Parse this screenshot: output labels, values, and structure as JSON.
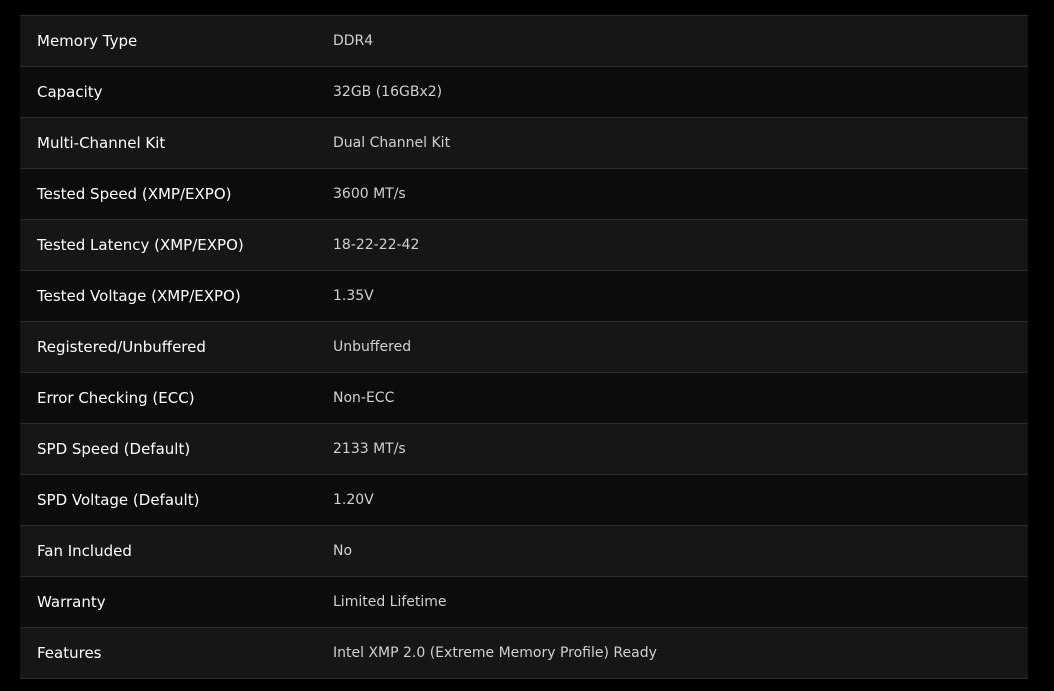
{
  "specs": [
    {
      "label": "Memory Type",
      "value": "DDR4"
    },
    {
      "label": "Capacity",
      "value": "32GB (16GBx2)"
    },
    {
      "label": "Multi-Channel Kit",
      "value": "Dual Channel Kit"
    },
    {
      "label": "Tested Speed (XMP/EXPO)",
      "value": "3600 MT/s"
    },
    {
      "label": "Tested Latency (XMP/EXPO)",
      "value": "18-22-22-42"
    },
    {
      "label": "Tested Voltage (XMP/EXPO)",
      "value": "1.35V"
    },
    {
      "label": "Registered/Unbuffered",
      "value": "Unbuffered"
    },
    {
      "label": "Error Checking (ECC)",
      "value": "Non-ECC"
    },
    {
      "label": "SPD Speed (Default)",
      "value": "2133 MT/s"
    },
    {
      "label": "SPD Voltage (Default)",
      "value": "1.20V"
    },
    {
      "label": "Fan Included",
      "value": "No"
    },
    {
      "label": "Warranty",
      "value": "Limited Lifetime"
    },
    {
      "label": "Features",
      "value": "Intel XMP 2.0 (Extreme Memory Profile) Ready"
    }
  ]
}
